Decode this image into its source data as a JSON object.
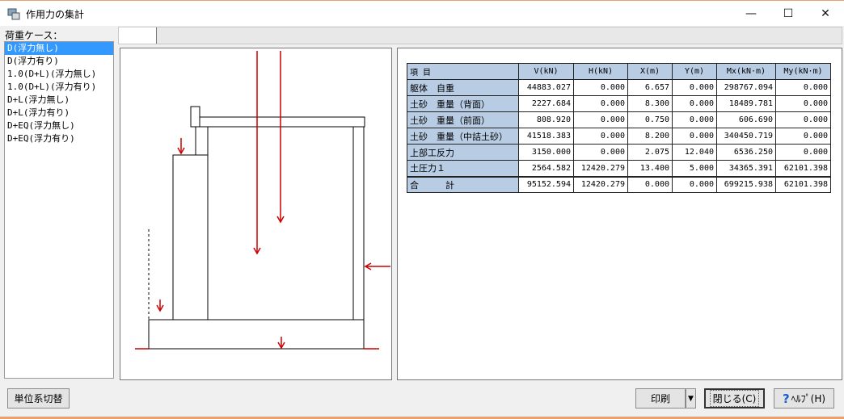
{
  "window": {
    "title": "作用力の集計",
    "minimize": "—",
    "maximize": "☐",
    "close": "✕"
  },
  "load_cases": {
    "label": "荷重ケース：",
    "items": [
      {
        "label": "D(浮力無し)",
        "selected": true
      },
      {
        "label": "D(浮力有り)"
      },
      {
        "label": "1.0(D+L)(浮力無し)"
      },
      {
        "label": "1.0(D+L)(浮力有り)"
      },
      {
        "label": "D+L(浮力無し)"
      },
      {
        "label": "D+L(浮力有り)"
      },
      {
        "label": "D+EQ(浮力無し)"
      },
      {
        "label": "D+EQ(浮力有り)"
      }
    ]
  },
  "table": {
    "headers": [
      "項 目",
      "V(kN)",
      "H(kN)",
      "X(m)",
      "Y(m)",
      "Mx(kN·m)",
      "My(kN·m)"
    ],
    "rows": [
      {
        "label": "躯体　自重",
        "values": [
          "44883.027",
          "0.000",
          "6.657",
          "0.000",
          "298767.094",
          "0.000"
        ]
      },
      {
        "label": "土砂　重量（背面）",
        "values": [
          "2227.684",
          "0.000",
          "8.300",
          "0.000",
          "18489.781",
          "0.000"
        ]
      },
      {
        "label": "土砂　重量（前面）",
        "values": [
          "808.920",
          "0.000",
          "0.750",
          "0.000",
          "606.690",
          "0.000"
        ]
      },
      {
        "label": "土砂　重量（中詰土砂）",
        "values": [
          "41518.383",
          "0.000",
          "8.200",
          "0.000",
          "340450.719",
          "0.000"
        ]
      },
      {
        "label": "上部工反力",
        "values": [
          "3150.000",
          "0.000",
          "2.075",
          "12.040",
          "6536.250",
          "0.000"
        ]
      },
      {
        "label": "土圧力１",
        "values": [
          "2564.582",
          "12420.279",
          "13.400",
          "5.000",
          "34365.391",
          "62101.398"
        ]
      },
      {
        "label": "合　　　計",
        "values": [
          "95152.594",
          "12420.279",
          "0.000",
          "0.000",
          "699215.938",
          "62101.398"
        ],
        "total": true
      }
    ]
  },
  "buttons": {
    "unit_switch": "単位系切替",
    "print": "印刷",
    "print_dropdown": "▼",
    "close": "閉じる(C)",
    "help": "ﾍﾙﾌﾟ(H)",
    "help_glyph": "?"
  },
  "colors": {
    "selection": "#3399ff",
    "header_fill": "#b8cce4",
    "force_arrow": "#cc0000"
  }
}
